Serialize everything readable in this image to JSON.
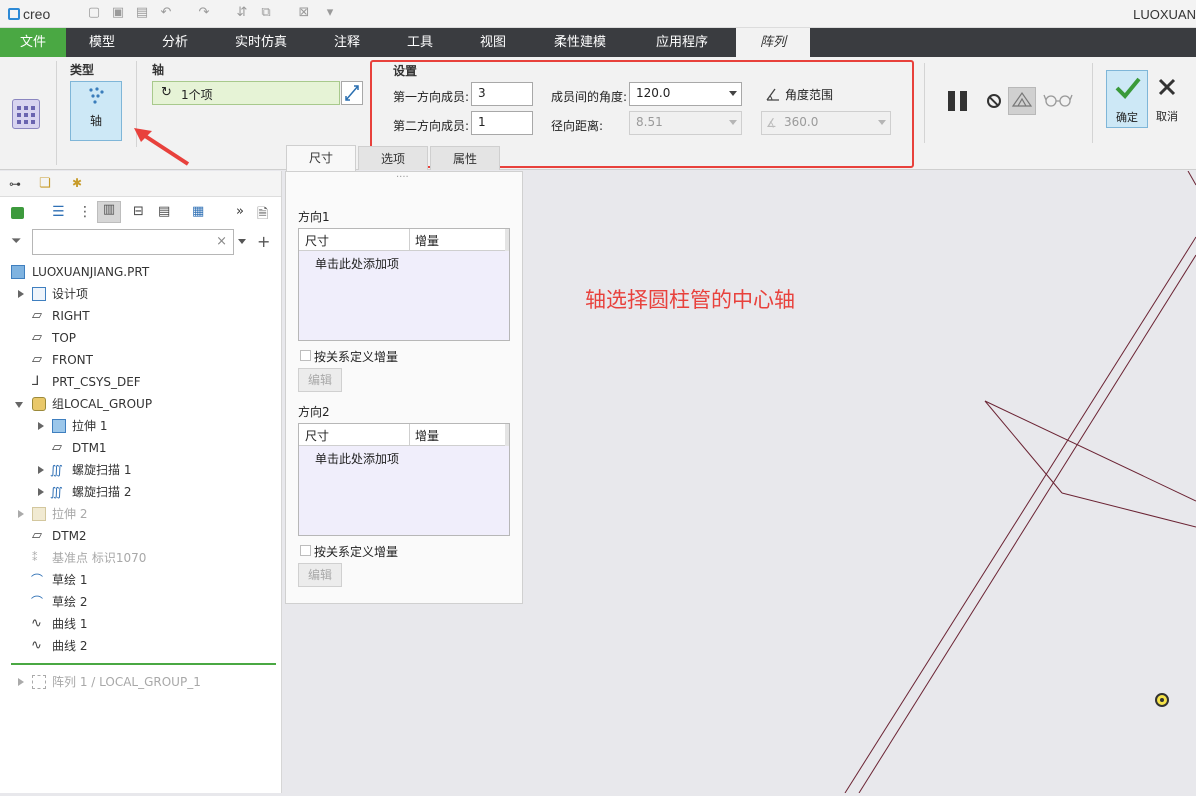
{
  "app": {
    "logo": "creo",
    "window_title": "LUOXUAN"
  },
  "ribbon_tabs": [
    "文件",
    "模型",
    "分析",
    "实时仿真",
    "注释",
    "工具",
    "视图",
    "柔性建模",
    "应用程序",
    "阵列"
  ],
  "ribbon": {
    "type_group": {
      "title": "类型",
      "selected": "轴"
    },
    "axis_group": {
      "title": "轴",
      "collector_value": "1个项"
    },
    "settings": {
      "title": "设置",
      "dir1_label": "第一方向成员:",
      "dir1_value": "3",
      "dir2_label": "第二方向成员:",
      "dir2_value": "1",
      "angle_label": "成员间的角度:",
      "angle_value": "120.0",
      "radial_label": "径向距离:",
      "radial_value": "8.51",
      "angle_range_label": "角度范围",
      "angle_range_value": "360.0"
    },
    "ok_label": "确定",
    "cancel_label": "取消",
    "subtabs": [
      "尺寸",
      "选项",
      "属性"
    ]
  },
  "tree": {
    "search_placeholder": "",
    "items": [
      "LUOXUANJIANG.PRT",
      "设计项",
      "RIGHT",
      "TOP",
      "FRONT",
      "PRT_CSYS_DEF",
      "组LOCAL_GROUP",
      "拉伸 1",
      "DTM1",
      "螺旋扫描 1",
      "螺旋扫描 2",
      "拉伸 2",
      "DTM2",
      "基准点 标识1070",
      "草绘 1",
      "草绘 2",
      "曲线 1",
      "曲线 2",
      "阵列 1 / LOCAL_GROUP_1"
    ]
  },
  "dim_panel": {
    "dir1_title": "方向1",
    "dir2_title": "方向2",
    "col_dim": "尺寸",
    "col_inc": "增量",
    "add_hint": "单击此处添加项",
    "relation_label": "按关系定义增量",
    "edit_label": "编辑"
  },
  "annotation": "轴选择圆柱管的中心轴",
  "colors": {
    "accent_green": "#4aa843",
    "highlight_red": "#e8413c",
    "tab_bar": "#3a3c40"
  }
}
